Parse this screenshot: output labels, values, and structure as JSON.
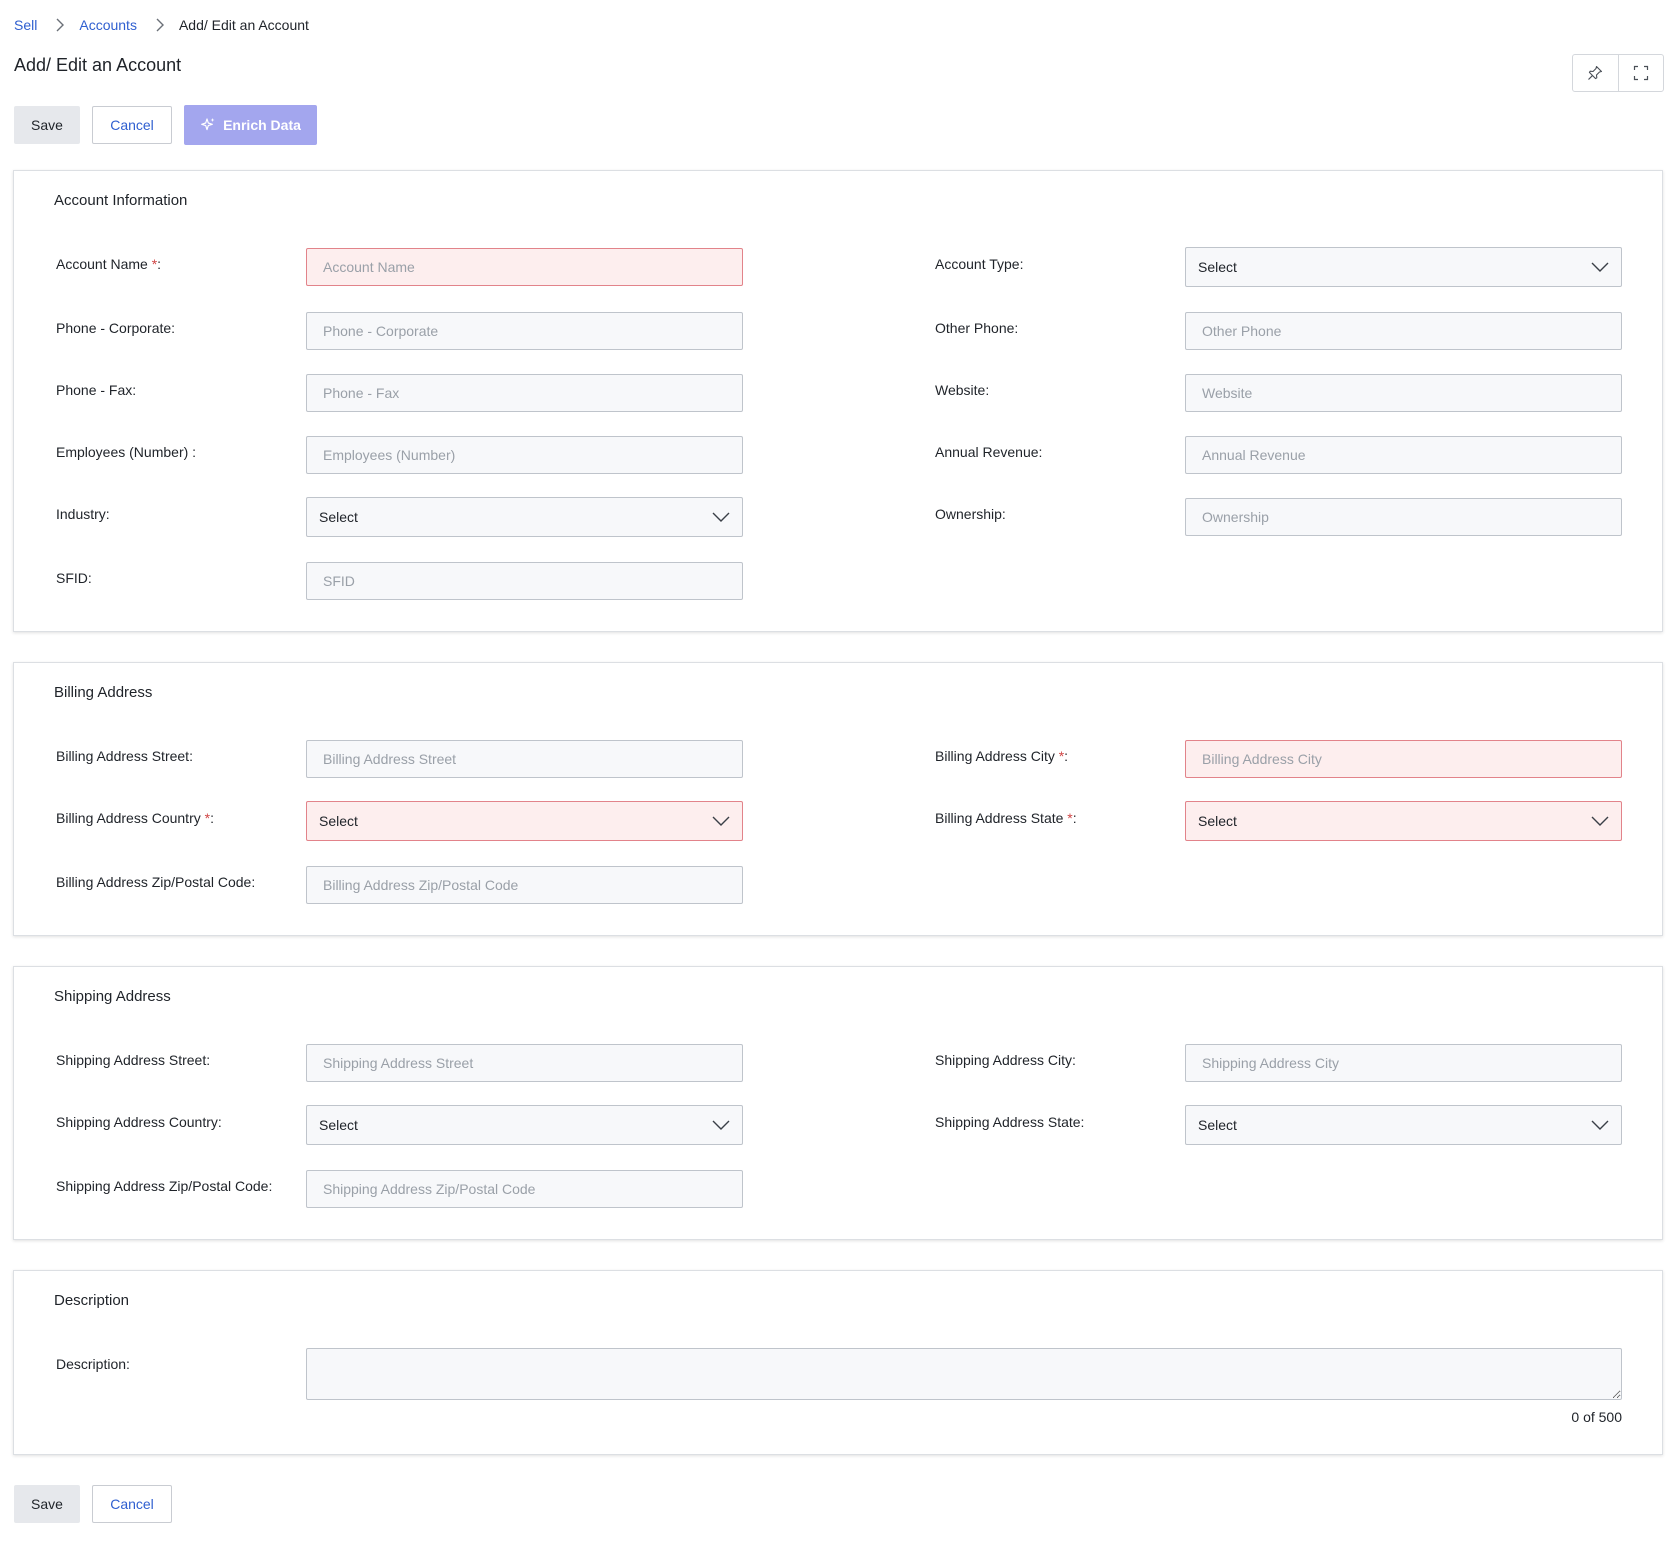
{
  "breadcrumb": {
    "items": [
      "Sell",
      "Accounts"
    ],
    "current": "Add/ Edit an Account"
  },
  "page": {
    "title": "Add/ Edit an Account"
  },
  "toolbar": {
    "save_label": "Save",
    "cancel_label": "Cancel",
    "enrich_label": "Enrich Data"
  },
  "account_info": {
    "title": "Account Information",
    "account_name": {
      "label": "Account Name",
      "required_mark": "*",
      "suffix": ":",
      "placeholder": "Account Name"
    },
    "account_type": {
      "label": "Account Type:",
      "value": "Select"
    },
    "phone_corporate": {
      "label": "Phone - Corporate:",
      "placeholder": "Phone - Corporate"
    },
    "other_phone": {
      "label": "Other Phone:",
      "placeholder": "Other Phone"
    },
    "phone_fax": {
      "label": "Phone - Fax:",
      "placeholder": "Phone - Fax"
    },
    "website": {
      "label": "Website:",
      "placeholder": "Website"
    },
    "employees": {
      "label": "Employees (Number) :",
      "placeholder": "Employees (Number)"
    },
    "annual_revenue": {
      "label": "Annual Revenue:",
      "placeholder": "Annual Revenue"
    },
    "industry": {
      "label": "Industry:",
      "value": "Select"
    },
    "ownership": {
      "label": "Ownership:",
      "placeholder": "Ownership"
    },
    "sfid": {
      "label": "SFID:",
      "placeholder": "SFID"
    }
  },
  "billing": {
    "title": "Billing Address",
    "street": {
      "label": "Billing Address Street:",
      "placeholder": "Billing Address Street"
    },
    "city": {
      "label": "Billing Address City",
      "required_mark": "*",
      "suffix": ":",
      "placeholder": "Billing Address City"
    },
    "country": {
      "label": "Billing Address Country",
      "required_mark": "*",
      "suffix": ":",
      "value": "Select"
    },
    "state": {
      "label": "Billing Address State",
      "required_mark": "*",
      "suffix": ":",
      "value": "Select"
    },
    "zip": {
      "label": "Billing Address Zip/Postal Code:",
      "placeholder": "Billing Address Zip/Postal Code"
    }
  },
  "shipping": {
    "title": "Shipping Address",
    "street": {
      "label": "Shipping Address Street:",
      "placeholder": "Shipping Address Street"
    },
    "city": {
      "label": "Shipping Address City:",
      "placeholder": "Shipping Address City"
    },
    "country": {
      "label": "Shipping Address Country:",
      "value": "Select"
    },
    "state": {
      "label": "Shipping Address State:",
      "value": "Select"
    },
    "zip": {
      "label": "Shipping Address Zip/Postal Code:",
      "placeholder": "Shipping Address Zip/Postal Code"
    }
  },
  "description": {
    "title": "Description",
    "label": "Description:",
    "value": "",
    "counter": "0 of 500"
  },
  "icons": {
    "pin": "pin-icon",
    "fullscreen": "fullscreen-icon",
    "sparkle": "sparkle-icon",
    "chevron": "chevron-down-icon",
    "breadcrumb_separator": "chevron-right-icon"
  },
  "colors": {
    "link": "#2f5fd0",
    "enrich_button": "#a3a6ee",
    "error_border": "#e2838a",
    "error_background": "#fdeeee",
    "required_mark": "#d04545"
  }
}
